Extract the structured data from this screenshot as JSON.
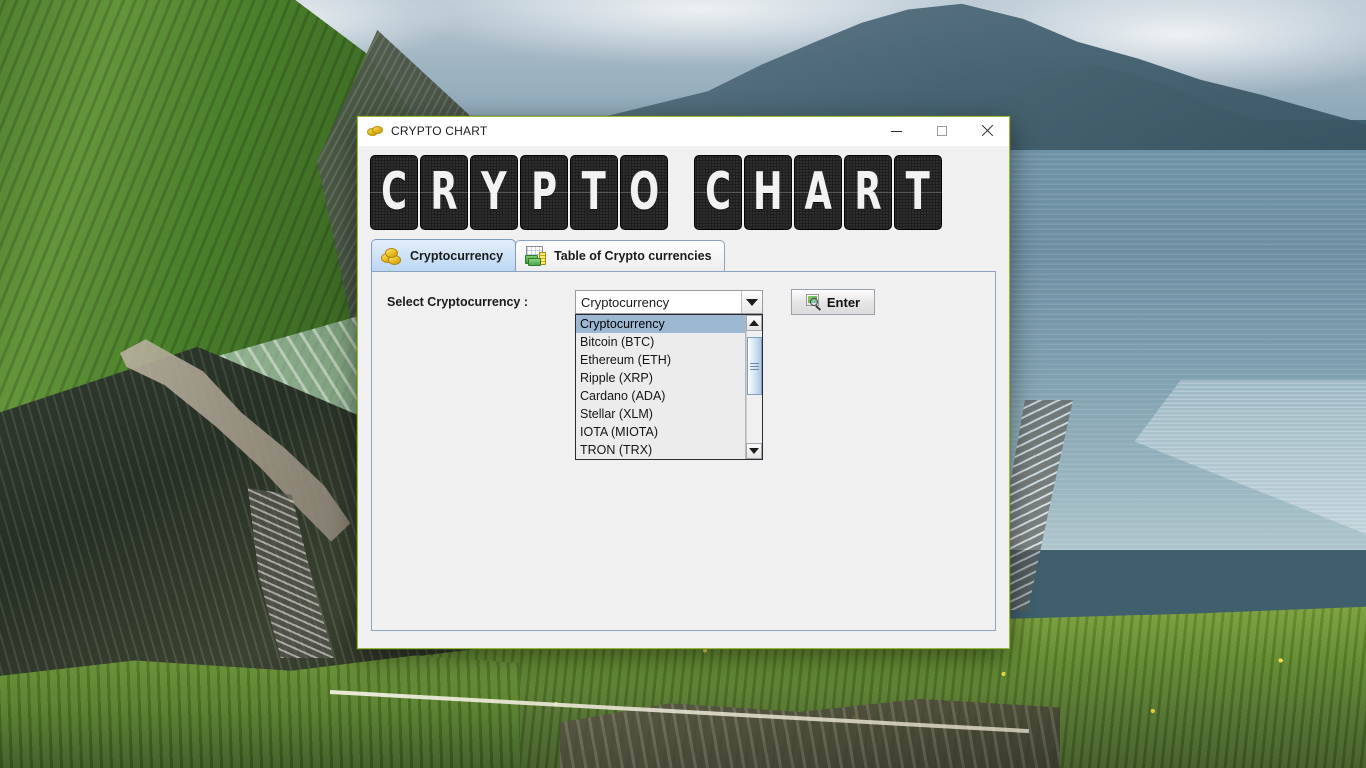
{
  "window": {
    "title": "CRYPTO CHART",
    "title_icon": "coins-icon",
    "controls": {
      "minimize": "–",
      "maximize": "□",
      "close": "✕"
    }
  },
  "banner": {
    "text": "CRYPTO CHART",
    "characters": [
      "C",
      "R",
      "Y",
      "P",
      "T",
      "O",
      " ",
      "C",
      "H",
      "A",
      "R",
      "T"
    ],
    "tile_color": "#1e1e1e",
    "char_color": "#f2f2f2"
  },
  "tabs": [
    {
      "label": "Cryptocurrency",
      "icon": "coins-icon",
      "active": true
    },
    {
      "label": "Table of Crypto currencies",
      "icon": "chart-money-icon",
      "active": false
    }
  ],
  "form": {
    "label": "Select Cryptocurrency :",
    "combo": {
      "value": "Cryptocurrency",
      "placeholder": "Cryptocurrency",
      "expanded": true,
      "arrow_icon": "chevron-down-icon",
      "options": [
        "Cryptocurrency",
        "Bitcoin (BTC)",
        "Ethereum (ETH)",
        "Ripple (XRP)",
        "Cardano (ADA)",
        "Stellar (XLM)",
        "IOTA (MIOTA)",
        "TRON (TRX)"
      ],
      "selected_index": 0
    },
    "enter_button": {
      "label": "Enter",
      "icon": "search-magnifier-icon"
    },
    "scrollbar": {
      "up_icon": "triangle-up-icon",
      "down_icon": "triangle-down-icon"
    }
  },
  "colors": {
    "window_border": "#96b93c",
    "panel_border": "#8ba2c0",
    "tab_active": "#bcd7f2",
    "selection": "#9db8d2",
    "face": "#f0f0f0"
  }
}
